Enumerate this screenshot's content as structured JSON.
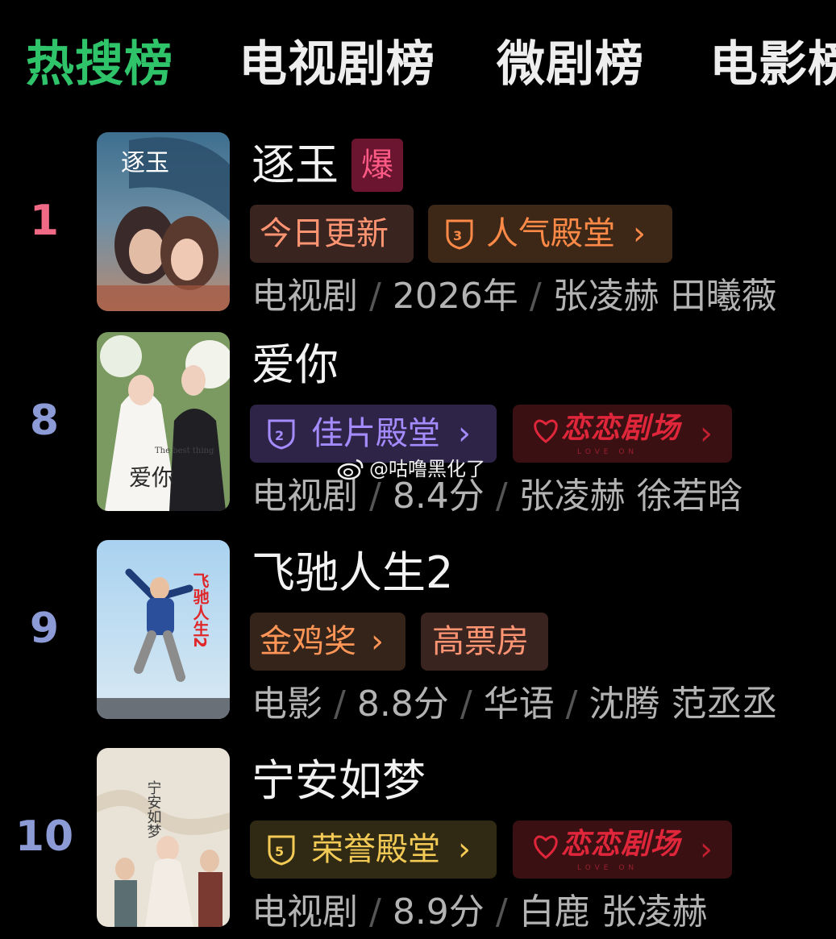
{
  "tabs": [
    {
      "label": "热搜榜",
      "active": true
    },
    {
      "label": "电视剧榜",
      "active": false
    },
    {
      "label": "微剧榜",
      "active": false
    },
    {
      "label": "电影榜",
      "active": false
    }
  ],
  "items": [
    {
      "rank": "1",
      "title": "逐玉",
      "hot_tag": "爆",
      "badges": [
        "今日更新",
        "人气殿堂"
      ],
      "badge_level": "3",
      "meta": [
        "电视剧",
        "2026年",
        "张凌赫 田曦薇"
      ],
      "poster_icon": "drama-poster-icon",
      "poster_text": "逐玉"
    },
    {
      "rank": "8",
      "title": "爱你",
      "badges": [
        "佳片殿堂"
      ],
      "badge_level": "2",
      "love_theater": {
        "label": "恋恋剧场",
        "sub": "LOVE ON"
      },
      "meta": [
        "电视剧",
        "8.4分",
        "张凌赫 徐若晗"
      ],
      "poster_text": "爱你",
      "poster_sub": "The best thing"
    },
    {
      "rank": "9",
      "title": "飞驰人生2",
      "badges": [
        "金鸡奖",
        "高票房"
      ],
      "meta": [
        "电影",
        "8.8分",
        "华语",
        "沈腾 范丞丞"
      ],
      "poster_text": "飞驰人生2"
    },
    {
      "rank": "10",
      "title": "宁安如梦",
      "badges": [
        "荣誉殿堂"
      ],
      "badge_level": "5",
      "love_theater": {
        "label": "恋恋剧场",
        "sub": "LOVE ON"
      },
      "meta": [
        "电视剧",
        "8.9分",
        "白鹿 张凌赫"
      ],
      "poster_text": "宁安如梦"
    }
  ],
  "watermark": "@咕噜黑化了",
  "colors": {
    "active_tab": "#2fc36a",
    "rank_top": "#f06a86",
    "rank_other": "#8c9ad6"
  }
}
